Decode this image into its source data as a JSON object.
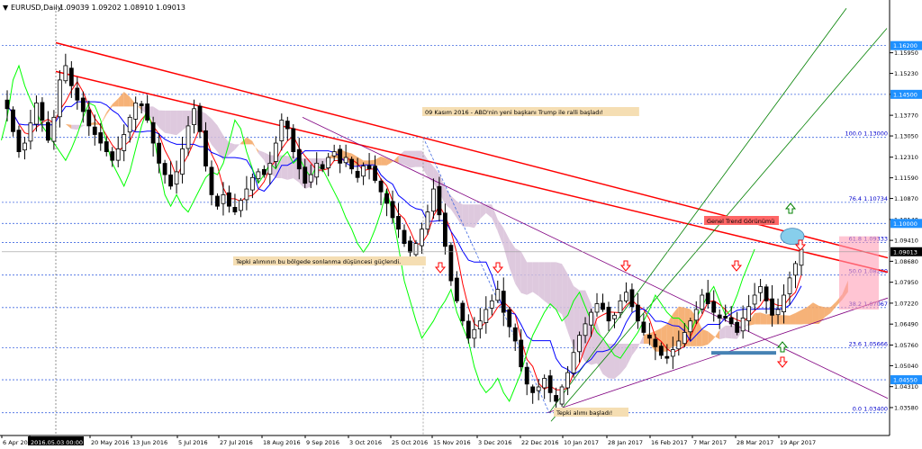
{
  "header": {
    "symbol": "EURUSD,Daily",
    "ohlc": "1.09039 1.09202 1.08910 1.09013",
    "menu_glyph": "▼"
  },
  "colors": {
    "candle": "#000000",
    "tenkan": "#ff0000",
    "kijun": "#0000ff",
    "chikou": "#00ff00",
    "kumo_bull": "#f4a460",
    "kumo_bear": "#d8bfd8",
    "trendline": "#ff0000",
    "channel": "#008000",
    "triangle": "#800080",
    "hline": "#4169e1",
    "current_price_bg": "#000000",
    "level_tag_bg": "#1e90ff",
    "note_bg": "#f5deb3",
    "red_note_bg": "#ff6666"
  },
  "chart_data": {
    "type": "candlestick",
    "symbol": "EURUSD",
    "timeframe": "Daily",
    "ylim": [
      1.0292,
      1.1735
    ],
    "y_ticks": [
      1.1595,
      1.1523,
      1.145,
      1.1377,
      1.1305,
      1.1231,
      1.1159,
      1.1087,
      1.1014,
      1.0941,
      1.0868,
      1.0795,
      1.0722,
      1.0649,
      1.0576,
      1.0504,
      1.0431,
      1.0358
    ],
    "y_tick_labels": [
      "1.15950",
      "1.15230",
      "1.14500",
      "1.13770",
      "1.13050",
      "1.12310",
      "1.11590",
      "1.10870",
      "1.10140",
      "1.09410",
      "1.08680",
      "1.07950",
      "1.07220",
      "1.06490",
      "1.05760",
      "1.05040",
      "1.04310",
      "1.03580"
    ],
    "x_ticks": [
      "6 Apr 20",
      "2016.05.03 00:00",
      "20 May 2016",
      "13 Jun 2016",
      "5 Jul 2016",
      "27 Jul 2016",
      "18 Aug 2016",
      "9 Sep 2016",
      "3 Oct 2016",
      "25 Oct 2016",
      "15 Nov 2016",
      "3 Dec 2016",
      "22 Dec 2016",
      "10 Jan 2017",
      "28 Jan 2017",
      "16 Feb 2017",
      "7 Mar 2017",
      "28 Mar 2017",
      "19 Apr 2017"
    ],
    "current_price": "1.09013",
    "close_path": [
      1.14,
      1.132,
      1.125,
      1.128,
      1.135,
      1.142,
      1.136,
      1.129,
      1.137,
      1.15,
      1.155,
      1.148,
      1.143,
      1.139,
      1.134,
      1.131,
      1.128,
      1.125,
      1.122,
      1.126,
      1.131,
      1.137,
      1.142,
      1.141,
      1.136,
      1.128,
      1.121,
      1.117,
      1.113,
      1.118,
      1.126,
      1.134,
      1.14,
      1.132,
      1.12,
      1.11,
      1.106,
      1.11,
      1.106,
      1.104,
      1.108,
      1.112,
      1.116,
      1.118,
      1.117,
      1.121,
      1.128,
      1.136,
      1.133,
      1.125,
      1.119,
      1.114,
      1.117,
      1.121,
      1.119,
      1.123,
      1.125,
      1.121,
      1.123,
      1.119,
      1.116,
      1.12,
      1.119,
      1.115,
      1.111,
      1.107,
      1.102,
      1.098,
      1.093,
      1.09,
      1.093,
      1.098,
      1.104,
      1.112,
      1.103,
      1.092,
      1.08,
      1.073,
      1.066,
      1.06,
      1.063,
      1.066,
      1.07,
      1.073,
      1.077,
      1.069,
      1.064,
      1.059,
      1.05,
      1.044,
      1.041,
      1.043,
      1.046,
      1.041,
      1.038,
      1.043,
      1.048,
      1.055,
      1.061,
      1.065,
      1.069,
      1.072,
      1.07,
      1.066,
      1.068,
      1.073,
      1.076,
      1.071,
      1.066,
      1.062,
      1.06,
      1.057,
      1.054,
      1.053,
      1.056,
      1.059,
      1.062,
      1.066,
      1.07,
      1.075,
      1.072,
      1.069,
      1.067,
      1.067,
      1.065,
      1.062,
      1.067,
      1.071,
      1.075,
      1.078,
      1.073,
      1.068,
      1.07,
      1.075,
      1.081,
      1.086,
      1.091
    ],
    "levels": [
      {
        "label": "1.16200",
        "value": 1.162,
        "tag": true
      },
      {
        "label": "1.14500",
        "value": 1.145,
        "tag": true
      },
      {
        "label": "1.10000",
        "value": 1.1,
        "tag": true
      },
      {
        "label": "1.04550",
        "value": 1.0455,
        "tag": true
      },
      {
        "label": "100.0 1.13000",
        "value": 1.13,
        "tag": false
      },
      {
        "label": "76.4 1.10734",
        "value": 1.10734,
        "tag": false
      },
      {
        "label": "61.8 1.09333",
        "value": 1.09333,
        "tag": false
      },
      {
        "label": "50.0 1.08200",
        "value": 1.082,
        "tag": false
      },
      {
        "label": "38.2 1.07067",
        "value": 1.07067,
        "tag": false
      },
      {
        "label": "23.6 1.05666",
        "value": 1.05666,
        "tag": false
      },
      {
        "label": "0.0 1.03400",
        "value": 1.034,
        "tag": false
      }
    ],
    "annotations": [
      {
        "text": "09 Kasım 2016 - ABD'nin yeni başkanı Trump ile ralli başladı!",
        "style": "note"
      },
      {
        "text": "Genel Trend Görünümü",
        "style": "red-note"
      },
      {
        "text": "Tepki alımının bu bölgede sonlanma düşüncesi güçlendi.",
        "style": "note"
      },
      {
        "text": "Tepki alımı başladı!",
        "style": "note"
      }
    ]
  }
}
